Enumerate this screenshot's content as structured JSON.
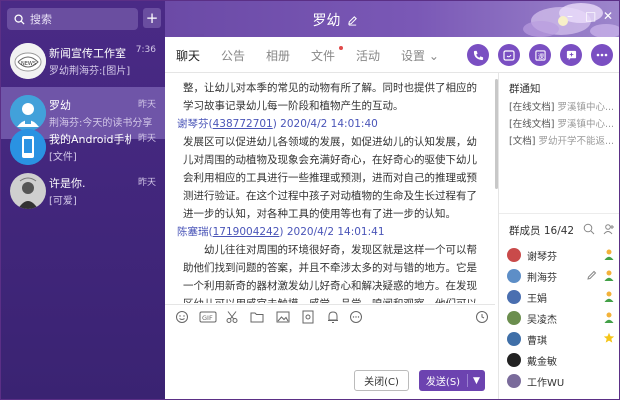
{
  "app": {
    "title": "罗幼"
  },
  "search": {
    "placeholder": "搜索"
  },
  "contacts": [
    {
      "name": "新闻宣传工作室",
      "sub": "罗幼荆海芬:[图片]",
      "time": "7:36"
    },
    {
      "name": "罗幼",
      "sub": "荆海芬:今天的读书分享",
      "time": "昨天"
    },
    {
      "name": "我的Android手机",
      "sub": "[文件]",
      "time": "昨天"
    },
    {
      "name": "许是你.",
      "sub": "[可爱]",
      "time": "昨天"
    }
  ],
  "tabs": [
    {
      "label": "聊天"
    },
    {
      "label": "公告"
    },
    {
      "label": "相册"
    },
    {
      "label": "文件"
    },
    {
      "label": "活动"
    },
    {
      "label": "设置 ⌄"
    }
  ],
  "messages": [
    {
      "text": "整，让幼儿对本季的常见的动物有所了解。同时也提供了相应的学习故事记录幼儿每一阶段和植物产生的互动。"
    },
    {
      "sender": "谢琴芬",
      "uid": "438772701",
      "time": "2020/4/2 14:01:40",
      "text": "发展区可以促进幼儿各领域的发展，如促进幼儿的认知发展，幼儿对周围的动植物及现象会充满好奇心，在好奇心的驱使下幼儿会利用相应的工具进行一些推理或预测，进而对自己的推理或预测进行验证。在这个过程中孩子对动植物的生命及生长过程有了进一步的认知，对各种工具的使用等也有了进一步的认知。"
    },
    {
      "sender": "陈塞瑞",
      "uid": "1719004242",
      "time": "2020/4/2 14:01:41",
      "text": "幼儿往往对周围的环境很好奇，发现区就是这样一个可以帮助他们找到问题的答案，并且不牵涉太多的对与错的地方。它是一个利用新奇的器材激发幼儿好奇心和解决疑惑的地方。在发现区幼儿可以用感官去触摸、感觉、品尝、嗅闻和观察。他们可以动手做一些事，就"
    }
  ],
  "buttons": {
    "close": "关闭(C)",
    "send": "发送(S)"
  },
  "notice": {
    "title": "群通知",
    "items": [
      {
        "tag": "[在线文档]",
        "text": "罗溪镇中心..."
      },
      {
        "tag": "[在线文档]",
        "text": "罗溪镇中心..."
      },
      {
        "tag": "[文档]",
        "text": "罗幼开学不能返..."
      }
    ]
  },
  "members": {
    "title": "群成员 16/42",
    "list": [
      {
        "name": "谢琴芬",
        "badge": "admin",
        "color": "#c94a4a"
      },
      {
        "name": "荆海芬",
        "badge": "admin",
        "color": "#5d8ec7"
      },
      {
        "name": "王娟",
        "badge": "admin",
        "color": "#4a6fb0"
      },
      {
        "name": "吴凌杰",
        "badge": "admin",
        "color": "#6b8e4e"
      },
      {
        "name": "曹琪",
        "badge": "star",
        "color": "#3f6fa8"
      },
      {
        "name": "戴金敏",
        "badge": "",
        "color": "#222"
      },
      {
        "name": "工作WU",
        "badge": "",
        "color": "#7a6b9b"
      }
    ]
  },
  "colors": {
    "accent": "#6c43b0",
    "sidebar": "#3f2679",
    "link": "#4a55b8"
  }
}
